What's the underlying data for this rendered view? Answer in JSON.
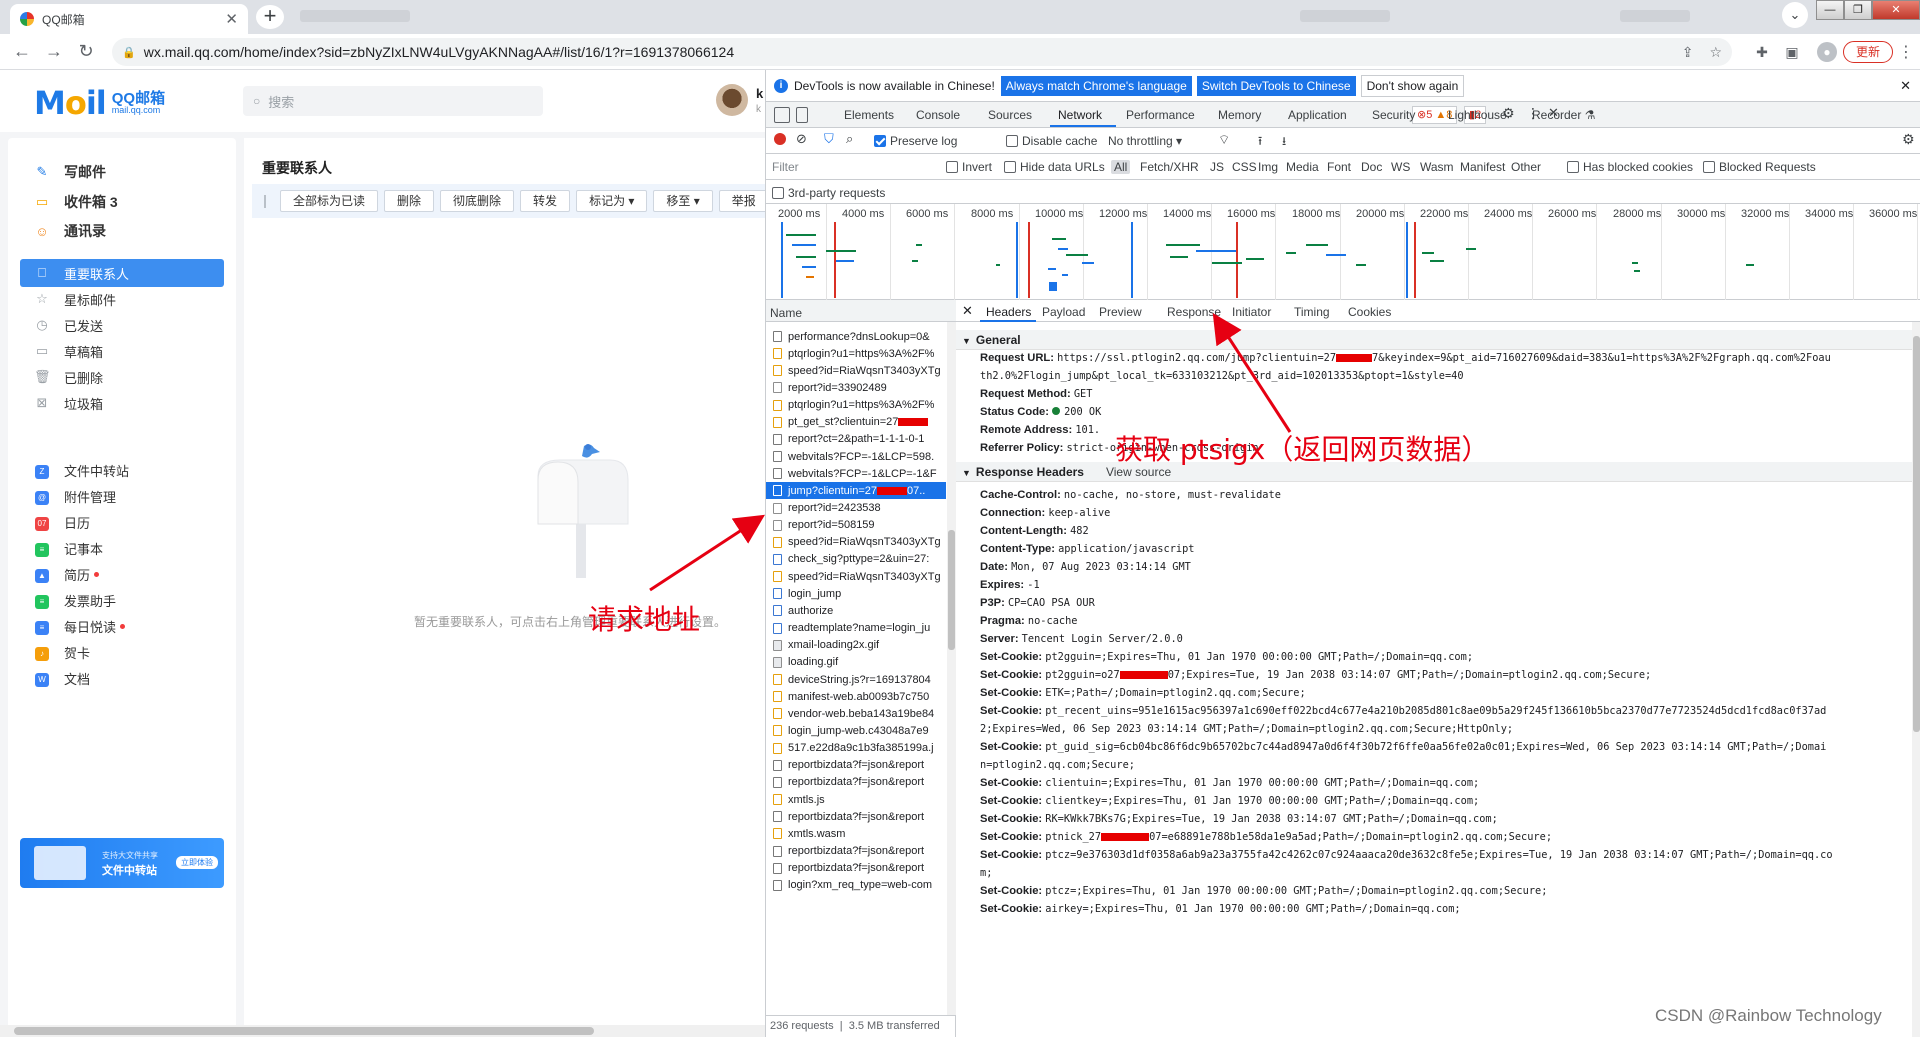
{
  "browser": {
    "tab_title": "QQ邮箱",
    "url": "wx.mail.qq.com/home/index?sid=zbNyZIxLNW4uLVgyAKNNagAA#/list/16/1?r=1691378066124",
    "update_label": "更新"
  },
  "mail": {
    "logo_main": "Mail",
    "logo_cn": "QQ邮箱",
    "logo_domain": "mail.qq.com",
    "search_placeholder": "搜索",
    "user_initial": "k",
    "user_sub": "k",
    "nav_top": [
      {
        "label": "写邮件",
        "icon": "pencil-icon"
      },
      {
        "label": "收件箱 3",
        "icon": "inbox-icon"
      },
      {
        "label": "通讯录",
        "icon": "contacts-icon"
      }
    ],
    "nav_folders": [
      {
        "label": "重要联系人",
        "icon": "bookmark-icon",
        "active": true
      },
      {
        "label": "星标邮件",
        "icon": "star-icon"
      },
      {
        "label": "已发送",
        "icon": "sent-icon"
      },
      {
        "label": "草稿箱",
        "icon": "draft-icon"
      },
      {
        "label": "已删除",
        "icon": "trash-icon"
      },
      {
        "label": "垃圾箱",
        "icon": "spam-icon"
      }
    ],
    "nav_apps": [
      {
        "label": "文件中转站",
        "icon": "file-transfer-icon",
        "color": "#3b82f6",
        "glyph": "Z"
      },
      {
        "label": "附件管理",
        "icon": "attachment-icon",
        "color": "#3b82f6",
        "glyph": "@"
      },
      {
        "label": "日历",
        "icon": "calendar-icon",
        "color": "#ef4444",
        "glyph": "07"
      },
      {
        "label": "记事本",
        "icon": "notepad-icon",
        "color": "#22c55e",
        "glyph": "≡"
      },
      {
        "label": "简历",
        "icon": "resume-icon",
        "color": "#3b82f6",
        "glyph": "▲",
        "dot": true
      },
      {
        "label": "发票助手",
        "icon": "invoice-icon",
        "color": "#22c55e",
        "glyph": "≡"
      },
      {
        "label": "每日悦读",
        "icon": "reading-icon",
        "color": "#3b82f6",
        "glyph": "≡",
        "dot": true
      },
      {
        "label": "贺卡",
        "icon": "greeting-card-icon",
        "color": "#f59e0b",
        "glyph": "♪"
      },
      {
        "label": "文档",
        "icon": "document-icon",
        "color": "#3b82f6",
        "glyph": "W"
      }
    ],
    "banner_small": "支持大文件共享",
    "banner_title": "文件中转站",
    "banner_btn": "立即体验",
    "page_title": "重要联系人",
    "toolbar_buttons": [
      "全部标为已读",
      "删除",
      "彻底删除",
      "转发",
      "标记为 ▾",
      "移至 ▾",
      "举报"
    ],
    "empty_text": "暂无重要联系人，可点击右上角管理重要联系人进行设置。"
  },
  "devtools": {
    "info_message": "DevTools is now available in Chinese!",
    "info_btn_match": "Always match Chrome's language",
    "info_btn_switch": "Switch DevTools to Chinese",
    "info_btn_dismiss": "Don't show again",
    "tabs": [
      "Elements",
      "Console",
      "Sources",
      "Network",
      "Performance",
      "Memory",
      "Application",
      "Security",
      "Lighthouse",
      "Recorder ⚗"
    ],
    "active_tab": "Network",
    "errors": "5",
    "warnings": "8",
    "issues": "2",
    "preserve_log": "Preserve log",
    "disable_cache": "Disable cache",
    "throttling": "No throttling",
    "filter_placeholder": "Filter",
    "invert": "Invert",
    "hide_data_urls": "Hide data URLs",
    "filter_types": [
      "All",
      "Fetch/XHR",
      "JS",
      "CSS",
      "Img",
      "Media",
      "Font",
      "Doc",
      "WS",
      "Wasm",
      "Manifest",
      "Other"
    ],
    "has_blocked_cookies": "Has blocked cookies",
    "blocked_requests": "Blocked Requests",
    "third_party": "3rd-party requests",
    "overview_ticks": [
      "2000 ms",
      "4000 ms",
      "6000 ms",
      "8000 ms",
      "10000 ms",
      "12000 ms",
      "14000 ms",
      "16000 ms",
      "18000 ms",
      "20000 ms",
      "22000 ms",
      "24000 ms",
      "26000 ms",
      "28000 ms",
      "30000 ms",
      "32000 ms",
      "34000 ms",
      "36000 ms"
    ],
    "name_header": "Name",
    "requests": [
      {
        "name": "performance?dnsLookup=0&",
        "type": "xhr"
      },
      {
        "name": "ptqrlogin?u1=https%3A%2F%",
        "type": "js"
      },
      {
        "name": "speed?id=RiaWqsnT3403yXTg",
        "type": "js"
      },
      {
        "name": "report?id=33902489",
        "type": "none"
      },
      {
        "name": "ptqrlogin?u1=https%3A%2F%",
        "type": "js"
      },
      {
        "name": "pt_get_st?clientuin=27",
        "type": "js",
        "redact": true
      },
      {
        "name": "report?ct=2&path=1-1-1-0-1",
        "type": "xhr"
      },
      {
        "name": "webvitals?FCP=-1&LCP=598.",
        "type": "xhr"
      },
      {
        "name": "webvitals?FCP=-1&LCP=-1&F",
        "type": "xhr"
      },
      {
        "name": "jump?clientuin=27",
        "type": "doc",
        "redact": true,
        "tail": "07..",
        "selected": true
      },
      {
        "name": "report?id=2423538",
        "type": "none"
      },
      {
        "name": "report?id=508159",
        "type": "none"
      },
      {
        "name": "speed?id=RiaWqsnT3403yXTg",
        "type": "js"
      },
      {
        "name": "check_sig?pttype=2&uin=27:",
        "type": "doc"
      },
      {
        "name": "speed?id=RiaWqsnT3403yXTg",
        "type": "js"
      },
      {
        "name": "login_jump",
        "type": "doc"
      },
      {
        "name": "authorize",
        "type": "doc"
      },
      {
        "name": "readtemplate?name=login_ju",
        "type": "doc"
      },
      {
        "name": "xmail-loading2x.gif",
        "type": "img"
      },
      {
        "name": "loading.gif",
        "type": "img"
      },
      {
        "name": "deviceString.js?r=169137804",
        "type": "js"
      },
      {
        "name": "manifest-web.ab0093b7c750",
        "type": "js"
      },
      {
        "name": "vendor-web.beba143a19be84",
        "type": "js"
      },
      {
        "name": "login_jump-web.c43048a7e9",
        "type": "js"
      },
      {
        "name": "517.e22d8a9c1b3fa385199a.j",
        "type": "js"
      },
      {
        "name": "reportbizdata?f=json&report",
        "type": "xhr"
      },
      {
        "name": "reportbizdata?f=json&report",
        "type": "xhr"
      },
      {
        "name": "xmtls.js",
        "type": "js"
      },
      {
        "name": "reportbizdata?f=json&report",
        "type": "xhr"
      },
      {
        "name": "xmtls.wasm",
        "type": "js"
      },
      {
        "name": "reportbizdata?f=json&report",
        "type": "xhr"
      },
      {
        "name": "reportbizdata?f=json&report",
        "type": "xhr"
      },
      {
        "name": "login?xm_req_type=web-com",
        "type": "xhr"
      }
    ],
    "footer_requests": "236 requests",
    "footer_transferred": "3.5 MB transferred",
    "detail_tabs": [
      "Headers",
      "Payload",
      "Preview",
      "Response",
      "Initiator",
      "Timing",
      "Cookies"
    ],
    "general_title": "General",
    "request_url_key": "Request URL:",
    "request_url_a": "https://ssl.ptlogin2.qq.com/jump?clientuin=27",
    "request_url_b": "7&keyindex=9&pt_aid=716027609&daid=383&u1=https%3A%2F%2Fgraph.qq.com%2Foau",
    "request_url_c": "th2.0%2Flogin_jump&pt_local_tk=633103212&pt_3rd_aid=102013353&ptopt=1&style=40",
    "method_key": "Request Method:",
    "method_val": "GET",
    "status_key": "Status Code:",
    "status_val": "200 OK",
    "remote_key": "Remote Address:",
    "remote_val": "101.",
    "referrer_key": "Referrer Policy:",
    "referrer_val": "strict-origin-when-cross-origin",
    "response_headers_title": "Response Headers",
    "view_source": "View source",
    "headers": [
      {
        "k": "Cache-Control:",
        "v": "no-cache, no-store, must-revalidate"
      },
      {
        "k": "Connection:",
        "v": "keep-alive"
      },
      {
        "k": "Content-Length:",
        "v": "482"
      },
      {
        "k": "Content-Type:",
        "v": "application/javascript"
      },
      {
        "k": "Date:",
        "v": "Mon, 07 Aug 2023 03:14:14 GMT"
      },
      {
        "k": "Expires:",
        "v": "-1"
      },
      {
        "k": "P3P:",
        "v": "CP=CAO PSA OUR"
      },
      {
        "k": "Pragma:",
        "v": "no-cache"
      },
      {
        "k": "Server:",
        "v": "Tencent Login Server/2.0.0"
      },
      {
        "k": "Set-Cookie:",
        "v": "pt2gguin=;Expires=Thu, 01 Jan 1970 00:00:00 GMT;Path=/;Domain=qq.com;"
      },
      {
        "k": "Set-Cookie:",
        "v": "pt2gguin=o27",
        "redact": true,
        "v2": "07;Expires=Tue, 19 Jan 2038 03:14:07 GMT;Path=/;Domain=ptlogin2.qq.com;Secure;"
      },
      {
        "k": "Set-Cookie:",
        "v": "ETK=;Path=/;Domain=ptlogin2.qq.com;Secure;"
      },
      {
        "k": "Set-Cookie:",
        "v": "pt_recent_uins=951e1615ac956397a1c690eff022bcd4c677e4a210b2085d801c8ae09b5a29f245f136610b5bca2370d77e7723524d5dcd1fcd8ac0f37ad",
        "wrap": "2;Expires=Wed, 06 Sep 2023 03:14:14 GMT;Path=/;Domain=ptlogin2.qq.com;Secure;HttpOnly;"
      },
      {
        "k": "Set-Cookie:",
        "v": "pt_guid_sig=6cb04bc86f6dc9b65702bc7c44ad8947a0d6f4f30b72f6ffe0aa56fe02a0c01;Expires=Wed, 06 Sep 2023 03:14:14 GMT;Path=/;Domai",
        "wrap": "n=ptlogin2.qq.com;Secure;"
      },
      {
        "k": "Set-Cookie:",
        "v": "clientuin=;Expires=Thu, 01 Jan 1970 00:00:00 GMT;Path=/;Domain=qq.com;"
      },
      {
        "k": "Set-Cookie:",
        "v": "clientkey=;Expires=Thu, 01 Jan 1970 00:00:00 GMT;Path=/;Domain=qq.com;"
      },
      {
        "k": "Set-Cookie:",
        "v": "RK=KWkk7BKs7G;Expires=Tue, 19 Jan 2038 03:14:07 GMT;Path=/;Domain=qq.com;"
      },
      {
        "k": "Set-Cookie:",
        "v": "ptnick_27",
        "redact": true,
        "v2": "07=e68891e788b1e58da1e9a5ad;Path=/;Domain=ptlogin2.qq.com;Secure;"
      },
      {
        "k": "Set-Cookie:",
        "v": "ptcz=9e376303d1df0358a6ab9a23a3755fa42c4262c07c924aaaca20de3632c8fe5e;Expires=Tue, 19 Jan 2038 03:14:07 GMT;Path=/;Domain=qq.co",
        "wrap": "m;"
      },
      {
        "k": "Set-Cookie:",
        "v": "ptcz=;Expires=Thu, 01 Jan 1970 00:00:00 GMT;Path=/;Domain=ptlogin2.qq.com;Secure;"
      },
      {
        "k": "Set-Cookie:",
        "v": "airkey=;Expires=Thu, 01 Jan 1970 00:00:00 GMT;Path=/;Domain=qq.com;"
      }
    ]
  },
  "annotations": {
    "request_address": "请求地址",
    "get_ptsigx": "获取 ptsigx（返回网页数据）",
    "annotation_color": "#e60012"
  },
  "watermark": "CSDN @Rainbow Technology"
}
